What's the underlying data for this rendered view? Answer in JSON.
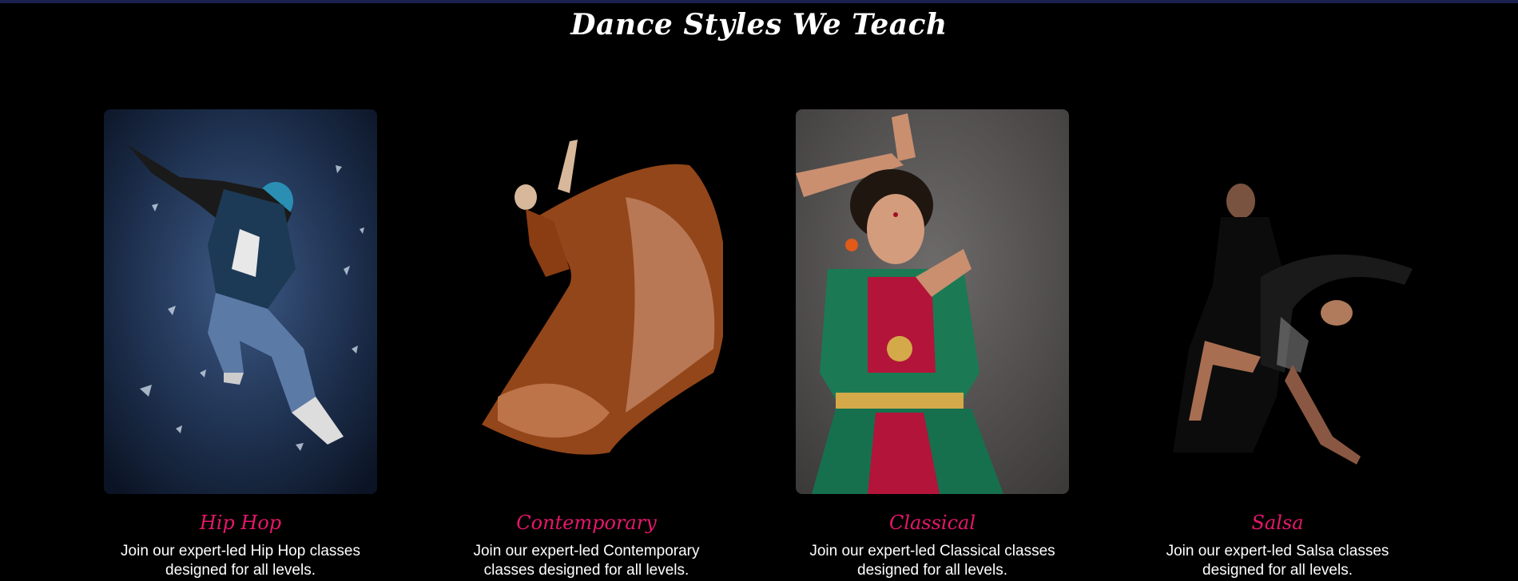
{
  "section": {
    "title": "Dance Styles We Teach"
  },
  "styles": [
    {
      "name": "Hip Hop",
      "description": "Join our expert-led Hip Hop classes designed for all levels."
    },
    {
      "name": "Contemporary",
      "description": "Join our expert-led Contemporary classes designed for all levels."
    },
    {
      "name": "Classical",
      "description": "Join our expert-led Classical classes designed for all levels."
    },
    {
      "name": "Salsa",
      "description": "Join our expert-led Salsa classes designed for all levels."
    }
  ],
  "colors": {
    "background": "#000000",
    "accent": "#e6176b",
    "top_bar": "#1b2250"
  }
}
